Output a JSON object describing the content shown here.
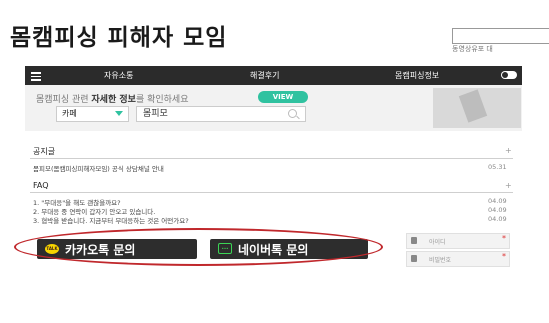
{
  "title": "몸캠피싱 피해자 모임",
  "top_links": "동영상유포  대",
  "nav": {
    "items": [
      "자유소통",
      "해결후기",
      "몸캠피싱정보"
    ]
  },
  "info": {
    "prefix": "몸캠피싱 관련 ",
    "highlight": "자세한 정보",
    "suffix": "를 확인하세요",
    "view_button": "VIEW"
  },
  "search": {
    "category": "카페",
    "query": "몸피모"
  },
  "notice": {
    "heading": "공지글",
    "plus": "+",
    "items": [
      {
        "text": "몸피모(몸캠피싱피해자모임) 공식 상담채널 안내",
        "date": "05.31"
      }
    ]
  },
  "faq": {
    "heading": "FAQ",
    "plus": "+",
    "items": [
      {
        "text": "1. \"무대응\"을 해도 괜찮을까요?",
        "date": "04.09"
      },
      {
        "text": "2. 무대응 중 연락이 갑자기 안오고 있습니다.",
        "date": "04.09"
      },
      {
        "text": "3. 협박을 받습니다. 지금부터 무대응하는 것은 어떤가요?",
        "date": "04.09"
      }
    ]
  },
  "buttons": {
    "kakao": "카카오톡 문의",
    "kakao_icon": "TALK",
    "naver": "네이버톡 문의",
    "naver_icon": "..."
  },
  "login": {
    "id_placeholder": "아이디",
    "pw_placeholder": "비밀번호",
    "required_mark": "*"
  },
  "colors": {
    "accent": "#30c2a0",
    "highlight_oval": "#c0282c",
    "nav_bg": "#2b2b2b",
    "kakao_yellow": "#f7d600",
    "naver_green": "#3cd455"
  }
}
